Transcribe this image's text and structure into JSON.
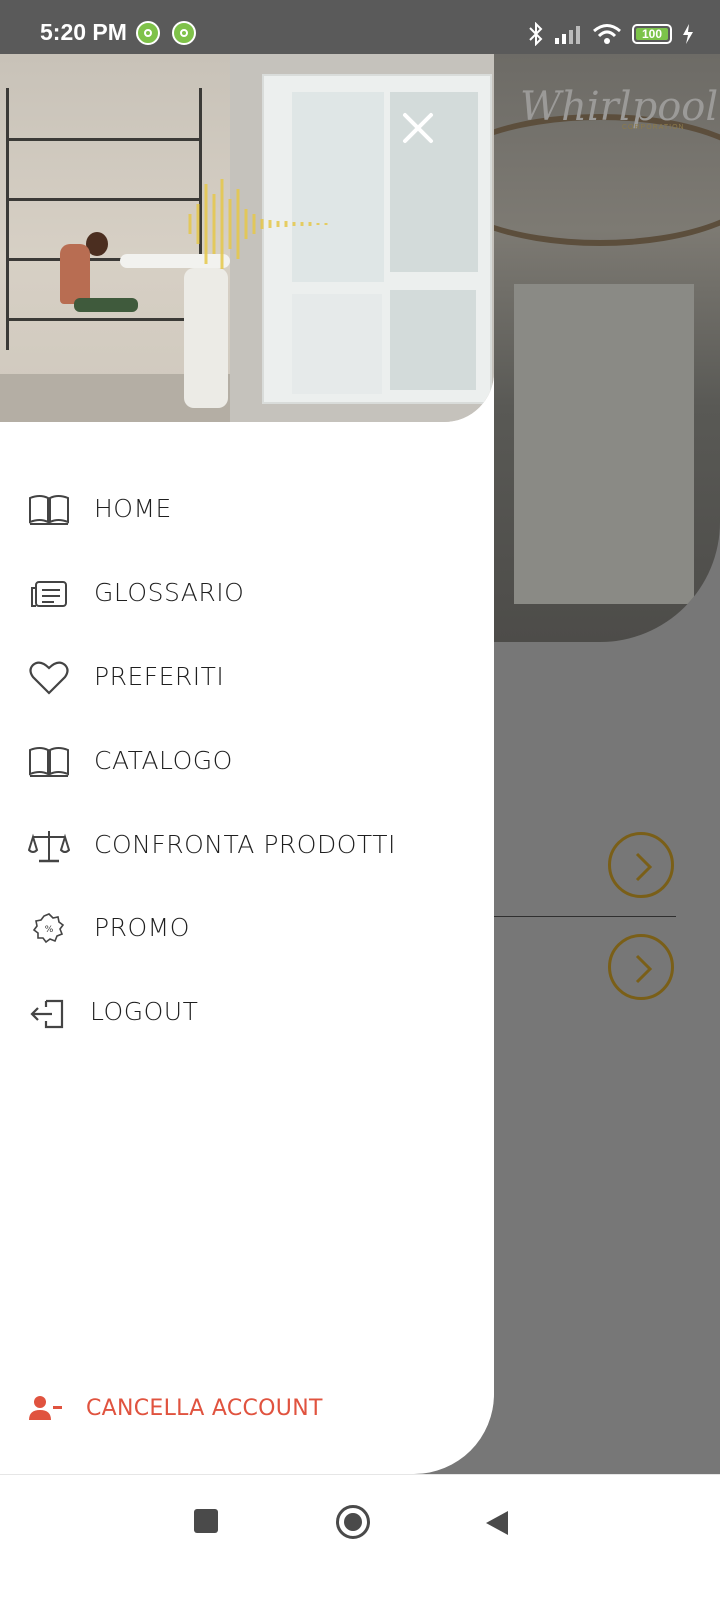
{
  "status_bar": {
    "time": "5:20 PM",
    "battery": "100"
  },
  "background": {
    "brand_logo": "Whirlpool",
    "brand_sub": "CORPORATION"
  },
  "drawer": {
    "menu": [
      {
        "label": "HOME",
        "icon": "book-open-icon"
      },
      {
        "label": "GLOSSARIO",
        "icon": "newspaper-icon"
      },
      {
        "label": "PREFERITI",
        "icon": "heart-icon"
      },
      {
        "label": "CATALOGO",
        "icon": "book-open-icon"
      },
      {
        "label": "CONFRONTA PRODOTTI",
        "icon": "scale-icon"
      },
      {
        "label": "PROMO",
        "icon": "discount-badge-icon"
      },
      {
        "label": "LOGOUT",
        "icon": "logout-icon"
      }
    ],
    "cancel_account": "CANCELLA ACCOUNT"
  },
  "colors": {
    "danger": "#e0533f",
    "accent": "#a07a16",
    "dot": "#7fc24a"
  }
}
